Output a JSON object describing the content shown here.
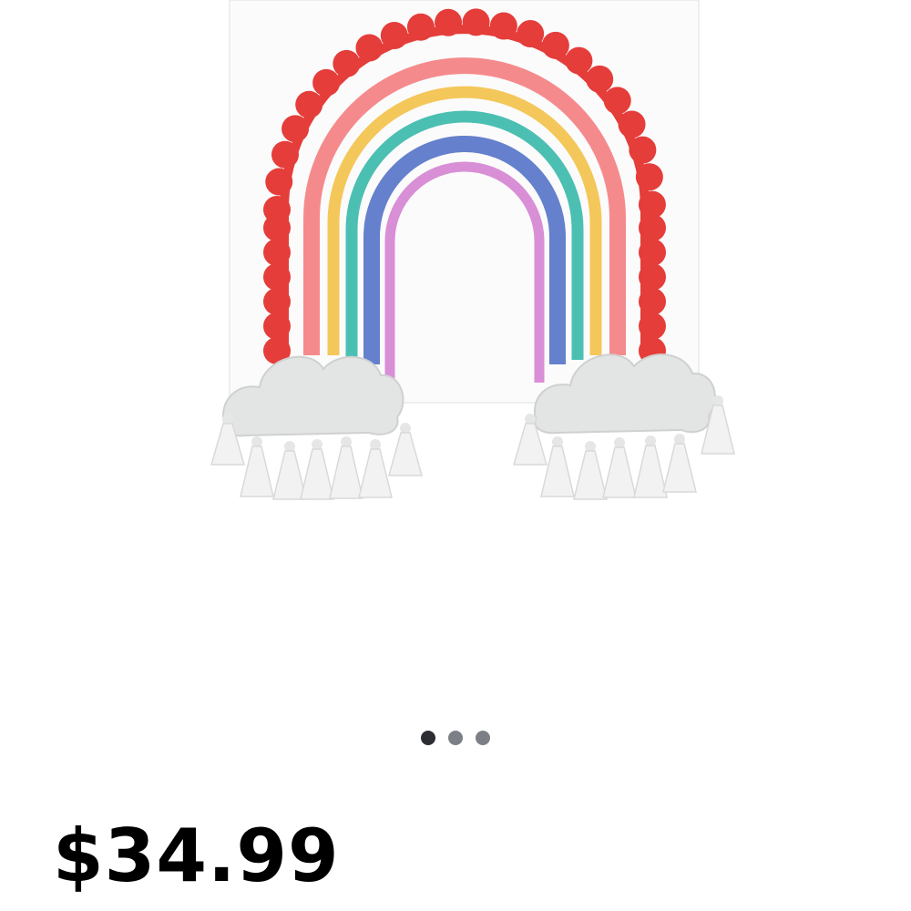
{
  "product": {
    "price": "$34.99",
    "image_icon": "rainbow-wall-hanging-icon"
  },
  "carousel": {
    "total_slides": 3,
    "active_index": 0,
    "active_color": "#2b2d33",
    "inactive_color": "#7d7f87"
  },
  "colors": {
    "scallop": "#e53d3a",
    "pink": "#f58a8d",
    "yellow": "#f4c75a",
    "teal": "#4cbfb3",
    "blue": "#6580cc",
    "lilac": "#d88fd6",
    "cloud": "#e3e4e4",
    "tassel": "#f2f2f2"
  }
}
